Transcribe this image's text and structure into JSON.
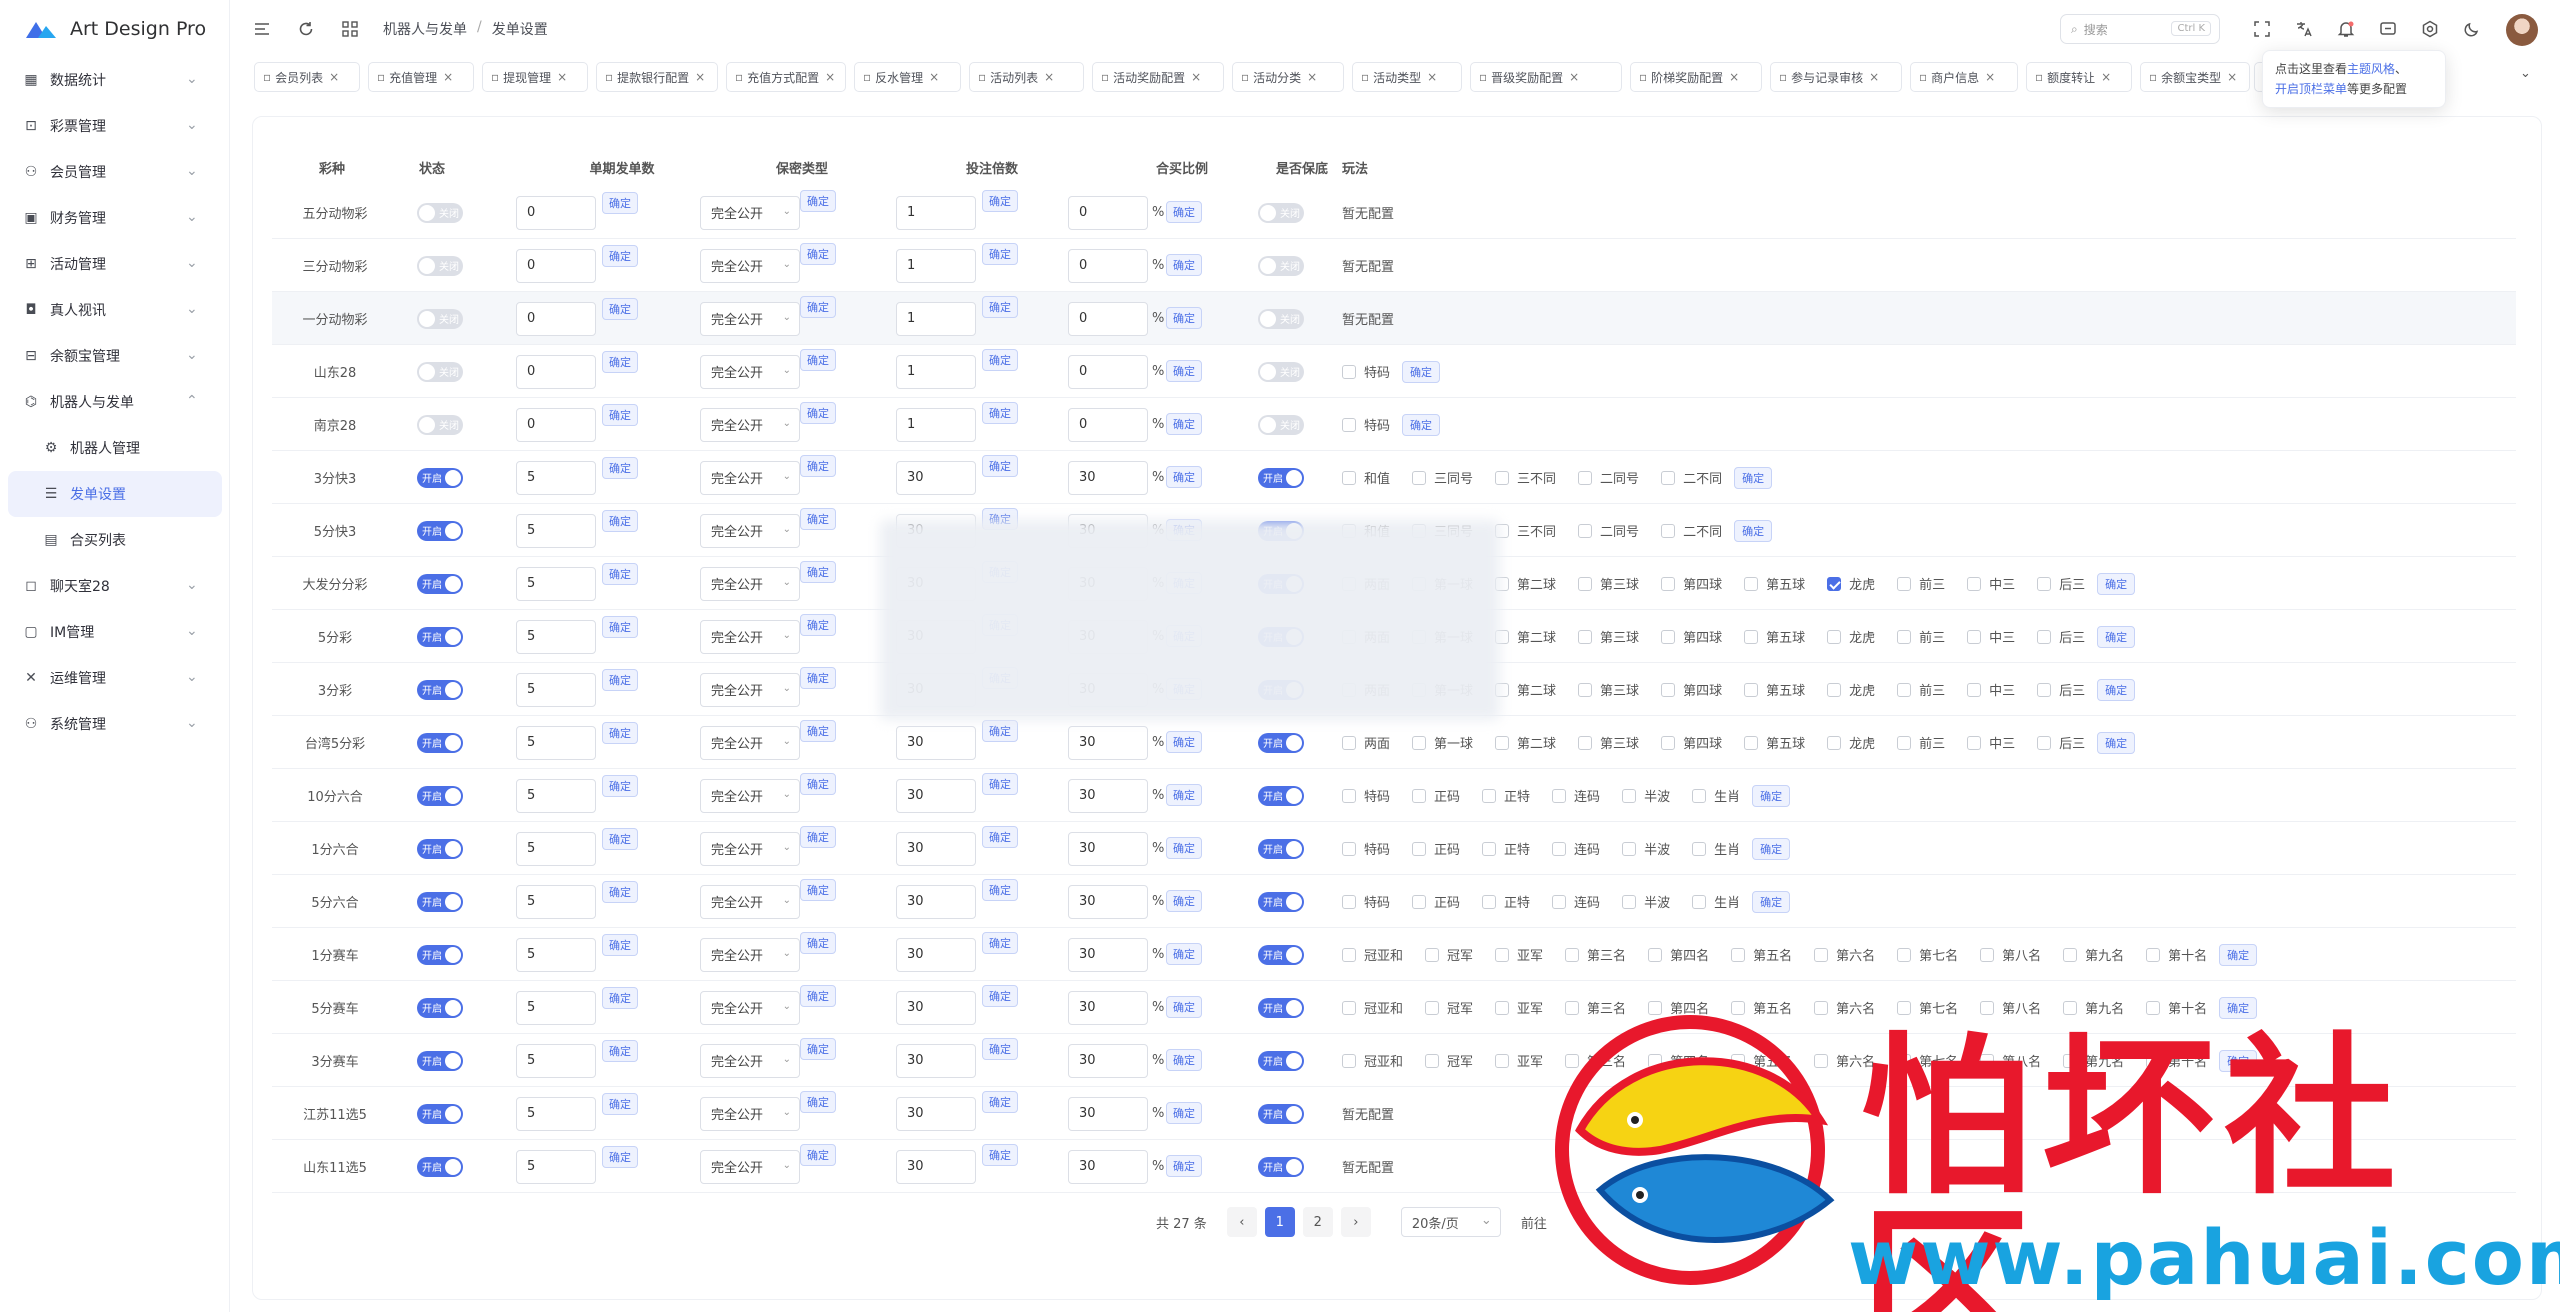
{
  "app": {
    "title": "Art Design Pro"
  },
  "sidebar": {
    "items": [
      {
        "label": "数据统计",
        "icon": "chart-icon"
      },
      {
        "label": "彩票管理",
        "icon": "lottery-icon"
      },
      {
        "label": "会员管理",
        "icon": "user-icon"
      },
      {
        "label": "财务管理",
        "icon": "wallet-icon"
      },
      {
        "label": "活动管理",
        "icon": "gift-icon"
      },
      {
        "label": "真人视讯",
        "icon": "video-icon"
      },
      {
        "label": "余额宝管理",
        "icon": "safe-icon"
      },
      {
        "label": "机器人与发单",
        "icon": "robot-icon"
      },
      {
        "label": "机器人管理",
        "icon": "gear-icon"
      },
      {
        "label": "发单设置",
        "icon": "setting-list-icon"
      },
      {
        "label": "合买列表",
        "icon": "document-icon"
      },
      {
        "label": "聊天室28",
        "icon": "chat-icon"
      },
      {
        "label": "IM管理",
        "icon": "message-icon"
      },
      {
        "label": "运维管理",
        "icon": "tools-icon"
      },
      {
        "label": "系统管理",
        "icon": "system-user-icon"
      }
    ]
  },
  "header": {
    "breadcrumb": [
      "机器人与发单",
      "/",
      "发单设置"
    ],
    "search_placeholder": "搜索",
    "search_kbd": "Ctrl K"
  },
  "tabs": [
    "会员列表",
    "充值管理",
    "提现管理",
    "提款银行配置",
    "充值方式配置",
    "反水管理",
    "活动列表",
    "活动奖励配置",
    "活动分类",
    "活动类型",
    "晋级奖励配置",
    "阶梯奖励配置",
    "参与记录审核",
    "商户信息",
    "额度转让",
    "余额宝类型",
    "设置"
  ],
  "tooltip": {
    "line1_a": "点击这里查看",
    "line1_b": "主题风格",
    "line1_c": "、",
    "line2_a": "开启顶栏菜单",
    "line2_b": "等更多配置"
  },
  "table": {
    "headers": [
      "彩种",
      "状态",
      "单期发单数",
      "保密类型",
      "投注倍数",
      "合买比例",
      "是否保底",
      "玩法"
    ],
    "confirm": "确定",
    "on_label": "开启",
    "off_label": "关闭",
    "percent": "%",
    "no_config": "暂无配置",
    "rows": [
      {
        "name": "五分动物彩",
        "status": false,
        "count": "0",
        "secret": "完全公开",
        "multi": "1",
        "ratio": "0",
        "guarantee": false,
        "plays": []
      },
      {
        "name": "三分动物彩",
        "status": false,
        "count": "0",
        "secret": "完全公开",
        "multi": "1",
        "ratio": "0",
        "guarantee": false,
        "plays": []
      },
      {
        "name": "一分动物彩",
        "status": false,
        "count": "0",
        "secret": "完全公开",
        "multi": "1",
        "ratio": "0",
        "guarantee": false,
        "plays": []
      },
      {
        "name": "山东28",
        "status": false,
        "count": "0",
        "secret": "完全公开",
        "multi": "1",
        "ratio": "0",
        "guarantee": false,
        "plays": [
          "特码"
        ]
      },
      {
        "name": "南京28",
        "status": false,
        "count": "0",
        "secret": "完全公开",
        "multi": "1",
        "ratio": "0",
        "guarantee": false,
        "plays": [
          "特码"
        ]
      },
      {
        "name": "3分快3",
        "status": true,
        "count": "5",
        "secret": "完全公开",
        "multi": "30",
        "ratio": "30",
        "guarantee": true,
        "plays": [
          "和值",
          "三同号",
          "三不同",
          "二同号",
          "二不同"
        ]
      },
      {
        "name": "5分快3",
        "status": true,
        "count": "5",
        "secret": "完全公开",
        "multi": "30",
        "ratio": "30",
        "guarantee": true,
        "plays": [
          "和值",
          "三同号",
          "三不同",
          "二同号",
          "二不同"
        ]
      },
      {
        "name": "大发分分彩",
        "status": true,
        "count": "5",
        "secret": "完全公开",
        "multi": "30",
        "ratio": "30",
        "guarantee": true,
        "plays": [
          "两面",
          "第一球",
          "第二球",
          "第三球",
          "第四球",
          "第五球",
          "龙虎",
          "前三",
          "中三",
          "后三"
        ],
        "checked": [
          "龙虎"
        ]
      },
      {
        "name": "5分彩",
        "status": true,
        "count": "5",
        "secret": "完全公开",
        "multi": "30",
        "ratio": "30",
        "guarantee": true,
        "plays": [
          "两面",
          "第一球",
          "第二球",
          "第三球",
          "第四球",
          "第五球",
          "龙虎",
          "前三",
          "中三",
          "后三"
        ]
      },
      {
        "name": "3分彩",
        "status": true,
        "count": "5",
        "secret": "完全公开",
        "multi": "30",
        "ratio": "30",
        "guarantee": true,
        "plays": [
          "两面",
          "第一球",
          "第二球",
          "第三球",
          "第四球",
          "第五球",
          "龙虎",
          "前三",
          "中三",
          "后三"
        ]
      },
      {
        "name": "台湾5分彩",
        "status": true,
        "count": "5",
        "secret": "完全公开",
        "multi": "30",
        "ratio": "30",
        "guarantee": true,
        "plays": [
          "两面",
          "第一球",
          "第二球",
          "第三球",
          "第四球",
          "第五球",
          "龙虎",
          "前三",
          "中三",
          "后三"
        ]
      },
      {
        "name": "10分六合",
        "status": true,
        "count": "5",
        "secret": "完全公开",
        "multi": "30",
        "ratio": "30",
        "guarantee": true,
        "plays": [
          "特码",
          "正码",
          "正特",
          "连码",
          "半波",
          "生肖"
        ]
      },
      {
        "name": "1分六合",
        "status": true,
        "count": "5",
        "secret": "完全公开",
        "multi": "30",
        "ratio": "30",
        "guarantee": true,
        "plays": [
          "特码",
          "正码",
          "正特",
          "连码",
          "半波",
          "生肖"
        ]
      },
      {
        "name": "5分六合",
        "status": true,
        "count": "5",
        "secret": "完全公开",
        "multi": "30",
        "ratio": "30",
        "guarantee": true,
        "plays": [
          "特码",
          "正码",
          "正特",
          "连码",
          "半波",
          "生肖"
        ]
      },
      {
        "name": "1分赛车",
        "status": true,
        "count": "5",
        "secret": "完全公开",
        "multi": "30",
        "ratio": "30",
        "guarantee": true,
        "plays": [
          "冠亚和",
          "冠军",
          "亚军",
          "第三名",
          "第四名",
          "第五名",
          "第六名",
          "第七名",
          "第八名",
          "第九名",
          "第十名"
        ]
      },
      {
        "name": "5分赛车",
        "status": true,
        "count": "5",
        "secret": "完全公开",
        "multi": "30",
        "ratio": "30",
        "guarantee": true,
        "plays": [
          "冠亚和",
          "冠军",
          "亚军",
          "第三名",
          "第四名",
          "第五名",
          "第六名",
          "第七名",
          "第八名",
          "第九名",
          "第十名"
        ]
      },
      {
        "name": "3分赛车",
        "status": true,
        "count": "5",
        "secret": "完全公开",
        "multi": "30",
        "ratio": "30",
        "guarantee": true,
        "plays": [
          "冠亚和",
          "冠军",
          "亚军",
          "第三名",
          "第四名",
          "第五名",
          "第六名",
          "第七名",
          "第八名",
          "第九名",
          "第十名"
        ]
      },
      {
        "name": "江苏11选5",
        "status": true,
        "count": "5",
        "secret": "完全公开",
        "multi": "30",
        "ratio": "30",
        "guarantee": true,
        "plays": []
      },
      {
        "name": "山东11选5",
        "status": true,
        "count": "5",
        "secret": "完全公开",
        "multi": "30",
        "ratio": "30",
        "guarantee": true,
        "plays": []
      }
    ]
  },
  "pagination": {
    "total": "共 27 条",
    "pages": [
      "1",
      "2"
    ],
    "current": "1",
    "page_size": "20条/页",
    "goto": "前往",
    "prev": "‹",
    "next": "›"
  },
  "watermark": {
    "text": "怕坏社区",
    "url": "www.pahuai.com"
  },
  "colors": {
    "accent": "#4b6fe6",
    "watermark_red": "#e8182c",
    "watermark_blue": "#19a3e0"
  }
}
